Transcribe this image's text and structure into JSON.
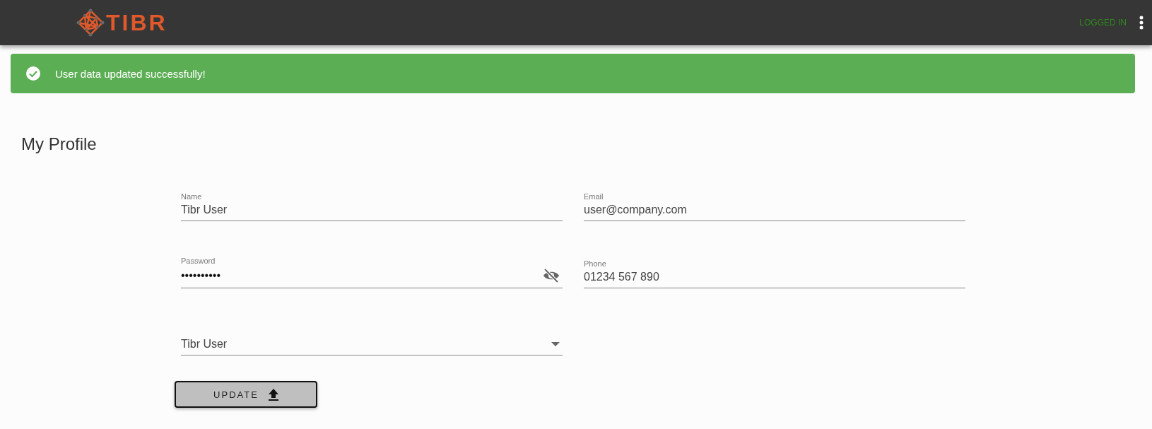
{
  "header": {
    "logo": "TIBR",
    "status": "LOGGED IN"
  },
  "alert": {
    "kind": "success",
    "message": "User data updated successfully!"
  },
  "page_title": "My Profile",
  "fields": [
    {
      "kind": "text",
      "label": "Name",
      "value": "Tibr User"
    },
    {
      "kind": "text",
      "label": "Email",
      "value": "user@company.com"
    },
    {
      "kind": "password",
      "label": "Password",
      "value": "••••••••••"
    },
    {
      "kind": "text",
      "label": "Phone",
      "value": "01234 567 890"
    },
    {
      "kind": "select",
      "value": "Tibr User"
    }
  ],
  "button": "UPDATE"
}
